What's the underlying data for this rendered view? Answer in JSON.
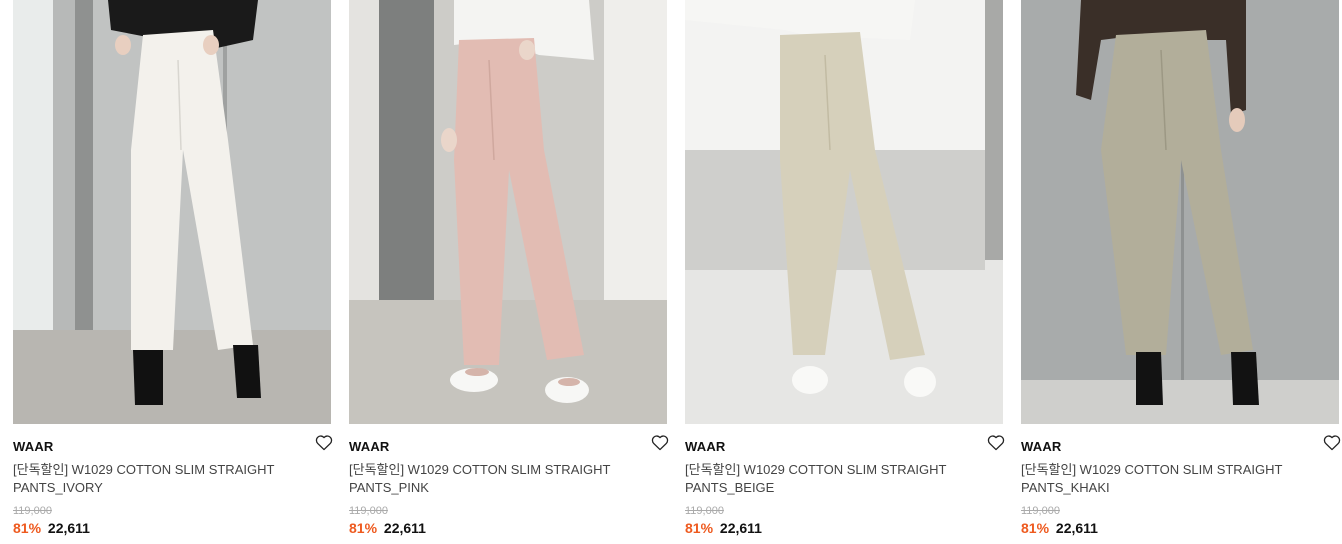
{
  "products": [
    {
      "brand": "WAAR",
      "title": "[단독할인] W1029 COTTON SLIM STRAIGHT PANTS_IVORY",
      "original_price": "119,000",
      "discount": "81%",
      "sale_price": "22,611",
      "pants_color": "#f3f1ec",
      "bg_color": "#cfcfcd",
      "top_color": "#1a1a1a",
      "shoe_color": "#111111"
    },
    {
      "brand": "WAAR",
      "title": "[단독할인] W1029 COTTON SLIM STRAIGHT PANTS_PINK",
      "original_price": "119,000",
      "discount": "81%",
      "sale_price": "22,611",
      "pants_color": "#e2bcb3",
      "bg_color": "#d9d8d5",
      "top_color": "#f4f4f2",
      "shoe_color": "#f7f7f5"
    },
    {
      "brand": "WAAR",
      "title": "[단독할인] W1029 COTTON SLIM STRAIGHT PANTS_BEIGE",
      "original_price": "119,000",
      "discount": "81%",
      "sale_price": "22,611",
      "pants_color": "#d6d0bb",
      "bg_color": "#e7e7e5",
      "top_color": "#f6f6f4",
      "shoe_color": "#f9f9f7"
    },
    {
      "brand": "WAAR",
      "title": "[단독할인] W1029 COTTON SLIM STRAIGHT PANTS_KHAKI",
      "original_price": "119,000",
      "discount": "81%",
      "sale_price": "22,611",
      "pants_color": "#b2ae9a",
      "bg_color": "#a8abab",
      "top_color": "#3a2f28",
      "shoe_color": "#121212"
    }
  ],
  "icons": {
    "wishlist": "heart-outline-icon"
  },
  "colors": {
    "discount": "#ee5a1f",
    "strikethrough_price": "#aaaaaa",
    "title_text": "#444444"
  }
}
